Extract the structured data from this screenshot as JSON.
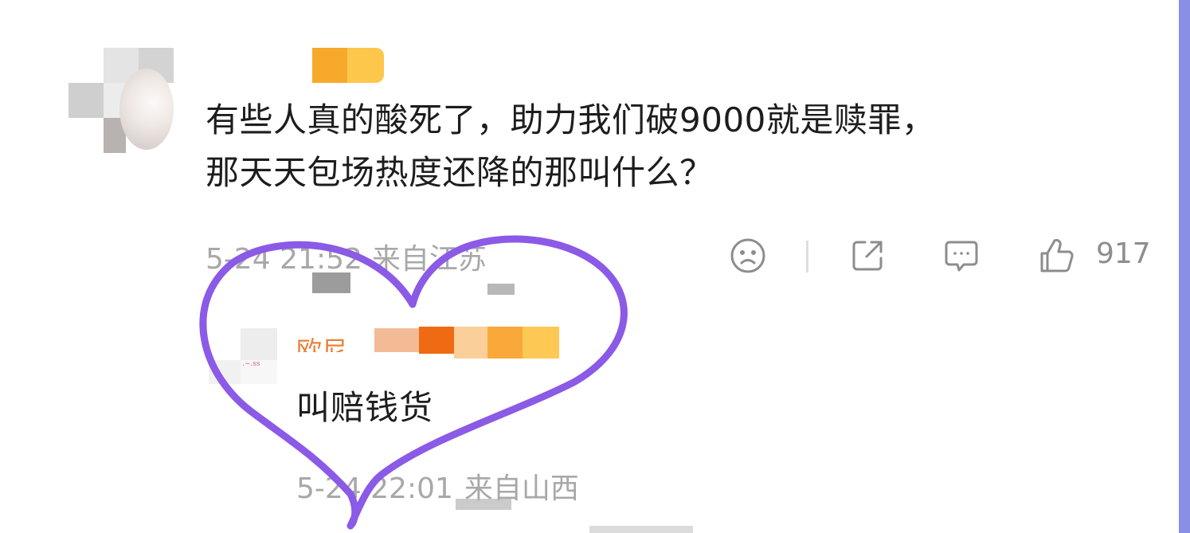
{
  "comment": {
    "text_line1": "有些人真的酸死了，助力我们破9000就是赎罪，",
    "text_line2": "那天天包场热度还降的那叫什么？",
    "date": "5-24 21:52",
    "location": "来自江苏",
    "like_count": "917",
    "icons": {
      "dislike": "sad-face-icon",
      "share": "share-icon",
      "reply": "comment-icon",
      "like": "thumbs-up-icon"
    }
  },
  "reply": {
    "username_partial": "欧尼",
    "text": "叫赔钱货",
    "date": "5-24 22:01",
    "location": "来自山西"
  },
  "annotation": {
    "shape": "heart",
    "color": "#8b5ae6"
  },
  "colors": {
    "text": "#1d1d1d",
    "meta": "#a8a8a8",
    "accent_edge": "#8a8fe6",
    "username_orange": "#f5a623"
  }
}
